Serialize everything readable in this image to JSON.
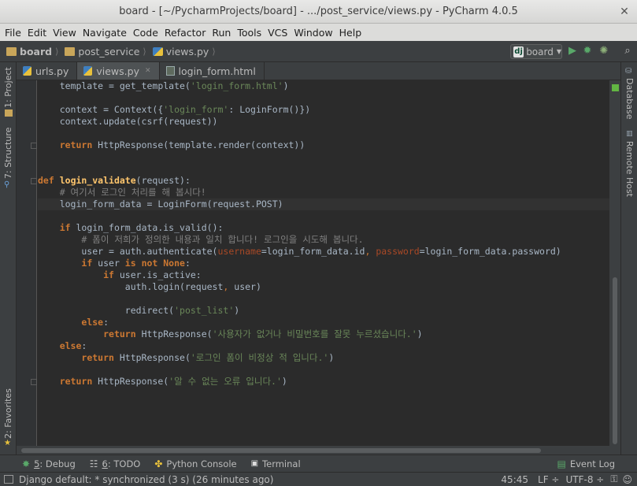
{
  "window": {
    "title": "board - [~/PycharmProjects/board] - .../post_service/views.py - PyCharm 4.0.5"
  },
  "menu": [
    "File",
    "Edit",
    "View",
    "Navigate",
    "Code",
    "Refactor",
    "Run",
    "Tools",
    "VCS",
    "Window",
    "Help"
  ],
  "breadcrumb": [
    "board",
    "post_service",
    "views.py"
  ],
  "run_config": {
    "label": "board",
    "badge": "dj"
  },
  "tabs": [
    {
      "label": "urls.py",
      "active": false
    },
    {
      "label": "views.py",
      "active": true
    },
    {
      "label": "login_form.html",
      "active": false
    }
  ],
  "left_panels": [
    "1: Project",
    "7: Structure",
    "2: Favorites"
  ],
  "right_panels": [
    "Database",
    "Remote Host"
  ],
  "tool_windows": [
    {
      "key": "5",
      "label": ": Debug",
      "icon": "bug-icon"
    },
    {
      "key": "6",
      "label": ": TODO",
      "icon": "todo-icon"
    },
    {
      "key": "",
      "label": "Python Console",
      "icon": "python-icon"
    },
    {
      "key": "",
      "label": "Terminal",
      "icon": "terminal-icon"
    }
  ],
  "event_log": "Event Log",
  "status": {
    "message": "Django default: * synchronized (3 s) (26 minutes ago)",
    "position": "45:45",
    "line_sep": "LF ÷",
    "encoding": "UTF-8 ÷"
  },
  "code_lines": [
    "    template = get_template('login_form.html')",
    "",
    "    context = Context({'login_form': LoginForm()})",
    "    context.update(csrf(request))",
    "",
    "    return HttpResponse(template.render(context))",
    "",
    "",
    "def login_validate(request):",
    "    # 여기서 로그인 처리를 해 봅시다!",
    "    login_form_data = LoginForm(request.POST)",
    "",
    "    if login_form_data.is_valid():",
    "        # 폼이 저희가 정의한 내용과 일치 합니다! 로그인을 시도해 봅니다.",
    "        user = auth.authenticate(username=login_form_data.id, password=login_form_data.password)",
    "        if user is not None:",
    "            if user.is_active:",
    "                auth.login(request, user)",
    "",
    "                redirect('post_list')",
    "        else:",
    "            return HttpResponse('사용자가 없거나 비밀번호를 잘못 누르셨습니다.')",
    "    else:",
    "        return HttpResponse('로그인 폼이 비정상 적 입니다.')",
    "",
    "    return HttpResponse('알 수 없는 오류 입니다.')"
  ],
  "colors": {
    "editor_bg": "#2b2b2b",
    "keyword": "#cc7832",
    "string": "#6a8759",
    "comment": "#808080",
    "function": "#ffc66d"
  }
}
